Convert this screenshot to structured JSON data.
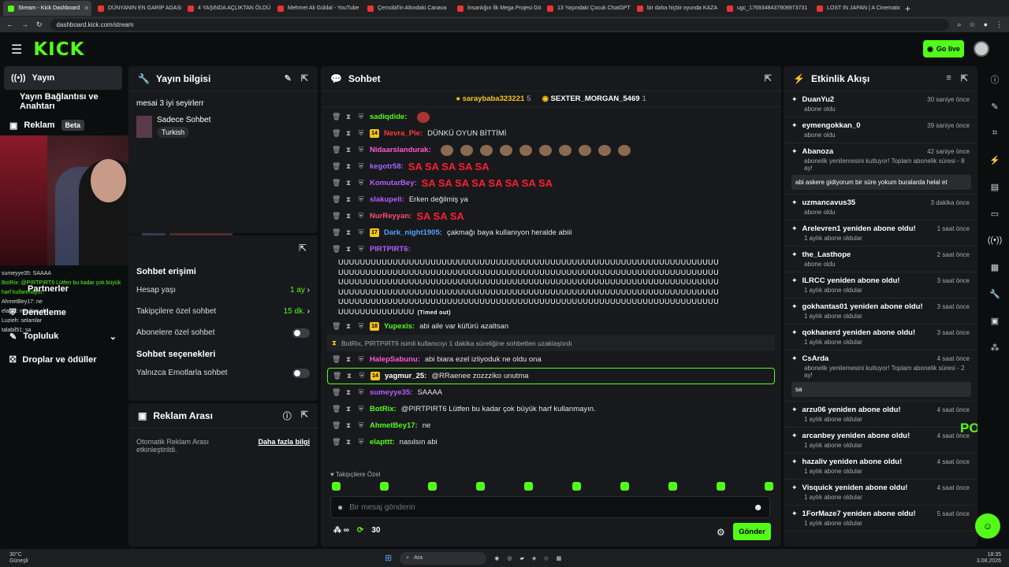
{
  "browser": {
    "tabs": [
      {
        "title": "Stream - Kick Dashboard",
        "kick": true
      },
      {
        "title": "DÜNYANIN EN GARİP ADASI"
      },
      {
        "title": "4 YAŞINDA AÇLIKTAN ÖLDÜ"
      },
      {
        "title": "Mehmet Ali Güldal - YouTube"
      },
      {
        "title": "Çernobil'in Altındaki Canava"
      },
      {
        "title": "İnsanlığın İlk Mega Projesi Gö"
      },
      {
        "title": "13 Yaşındaki Çocuk ChatGPT"
      },
      {
        "title": "bir daha hiçbir oyunda KAZA"
      },
      {
        "title": "ugc_1769348437908973731"
      },
      {
        "title": "LOST IN JAPAN | A Cinematic"
      }
    ],
    "url": "dashboard.kick.com/stream"
  },
  "topnav": {
    "logo": "KICK",
    "golive": "Go live"
  },
  "sidebar": {
    "items": [
      {
        "label": "Yayın"
      },
      {
        "label": "Yayın Bağlantısı ve Anahtarı"
      },
      {
        "label": "Reklam",
        "badge": "Beta"
      },
      {
        "label": "Partnerler"
      },
      {
        "label": "Denetleme"
      },
      {
        "label": "Topluluk"
      },
      {
        "label": "Droplar ve ödüller"
      }
    ]
  },
  "overlay_chat": [
    "sumeyye35: SAAAA",
    "BotRix: @PIRTPIRT6 Lütfen bu kadar çok büyük harf kullanmayın.",
    "AhmetBey17: ne",
    "elapttt: nasılsın abi",
    "Luzieh: selamlar",
    "talabil51: sa"
  ],
  "stream_info": {
    "title": "Yayın bilgisi",
    "stream_title": "mesai 3 iyi seyirlerr",
    "category": "Sadece Sohbet",
    "tag": "Turkish"
  },
  "chat_access": {
    "title": "Sohbet erişimi",
    "rows": [
      {
        "label": "Hesap yaşı",
        "value": "1 ay"
      },
      {
        "label": "Takipçilere özel sohbet",
        "value": "15 dk."
      },
      {
        "label": "Abonelere özel sohbet"
      }
    ],
    "options_title": "Sohbet seçenekleri",
    "options": [
      {
        "label": "Yalnızca Emotlarla sohbet"
      }
    ]
  },
  "ad_break": {
    "title": "Reklam Arası",
    "text": "Otomatik Reklam Arası etkinleştirildi.",
    "link": "Daha fazla bilgi"
  },
  "chat": {
    "title": "Sohbet",
    "pinned": [
      {
        "name": "saraybaba323221",
        "count": "5"
      },
      {
        "name": "SEXTER_MORGAN_5469",
        "count": "1"
      }
    ],
    "messages": [
      {
        "user": "sadiqdide",
        "color": "#53fc18",
        "text": ""
      },
      {
        "user": "Nevra_Pie",
        "color": "#ff3b3b",
        "badge": "14",
        "text": "DÜNKÜ OYUN BİTTİMİ"
      },
      {
        "user": "Nidaarslandurak",
        "color": "#ff5ad2",
        "text": ""
      },
      {
        "user": "kegotr58",
        "color": "#9b6bff",
        "text": "SA SA SA SA SA",
        "big": true
      },
      {
        "user": "KomutarBey",
        "color": "#b75cff",
        "text": "SA SA SA SA SA SA SA SA",
        "big": true
      },
      {
        "user": "slakupeli",
        "color": "#b75cff",
        "text": "Erken değilmiş ya"
      },
      {
        "user": "NurReyyan",
        "color": "#ff4d6d",
        "text": "SA SA SA",
        "big": true
      },
      {
        "user": "Dark_night1905",
        "color": "#4fa3ff",
        "badge": "17",
        "text": "çakmağı baya kullanıyon heralde abiii"
      },
      {
        "user": "PIRTPIRT6",
        "color": "#b75cff",
        "text": ""
      }
    ],
    "spam": "UUUUUUUUUUUUUUUUUUUUUUUUUUUUUUUUUUUUUUUUUUUUUUUUUUUUUUUUUUUUUUUUUUUUUUUUUUUUUUUUUUUUUUUUUUUUUUUUUUUUUUUUUUUUUUUUUUUUUUUUUUUUUUUUUUUUUUUUUUUUUUUUUUUUUUUUUUUUUUUUUUUUUUUUUUUUUUUUUUUUUUUUUUUUUUUUUUUUUUUUUUUUUUUUUUUUUUUUUUUUUUUUUUUUUUUUUUUUUUUUUUUUUUUUUUUUUUUUUUUUUUUUUUUUUUUUUUUUUUUUUUUUUUUUUUUUUUUUUUUUUUUUUUUUUUUUUUUUUUUUUUUUUUUUUUUUUUUUUUUUUUUUUUUUUUUUUUUUUUUUUUUU",
    "spam_tag": "(Timed out)",
    "messages2": [
      {
        "user": "Yupexis",
        "color": "#53fc18",
        "badge": "18",
        "text": "abi aile var küfürü azaltsan"
      },
      {
        "system": "BotRix, PIRTPIRT6 isimli kullanıcıyı 1 dakika süreliğine sohbetten uzaklaştırdı"
      },
      {
        "user": "HalepSabunu",
        "color": "#ff5ad2",
        "text": "abi biara ezel izliyoduk ne oldu ona"
      },
      {
        "user": "yagmur_25",
        "color": "#ffffff",
        "badge": "14",
        "text": "@RRaenee zozzziko unutma",
        "highlight": true
      },
      {
        "user": "sumeyye35",
        "color": "#b75cff",
        "text": "SAAAA"
      },
      {
        "user": "BotRix",
        "color": "#53fc18",
        "text": "@PIRTPIRT6 Lütfen bu kadar çok büyük harf kullanmayın."
      },
      {
        "user": "AhmetBey17",
        "color": "#53fc18",
        "text": "ne"
      },
      {
        "user": "elapttt",
        "color": "#53fc18",
        "text": "nasılsın abi"
      }
    ],
    "followers_label": "Takipçilere Özel",
    "input_placeholder": "Bir mesaj gönderin",
    "points": "30",
    "send": "Gönder"
  },
  "activity": {
    "title": "Etkinlik Akışı",
    "items": [
      {
        "name": "DuanYu2",
        "time": "30 saniye önce",
        "sub": "abone oldu"
      },
      {
        "name": "eymengokkan_0",
        "time": "39 saniye önce",
        "sub": "abone oldu"
      },
      {
        "name": "Abanoza",
        "time": "42 saniye önce",
        "sub": "abonelik yenilemesini kutluyor! Toplam abonelik süresi - 8 ay!",
        "msg": "abi askere gidiyorum bir süre yokum buralarda helal et"
      },
      {
        "name": "uzmancavus35",
        "time": "3 dakika önce",
        "sub": "abone oldu"
      },
      {
        "name": "Arelevren1 yeniden abone oldu!",
        "time": "1 saat önce",
        "sub": "1 aylık abone oldular"
      },
      {
        "name": "the_Lasthope",
        "time": "2 saat önce",
        "sub": "abone oldu"
      },
      {
        "name": "ILRCC yeniden abone oldu!",
        "time": "3 saat önce",
        "sub": "1 aylık abone oldular"
      },
      {
        "name": "gokhantas01 yeniden abone oldu!",
        "time": "3 saat önce",
        "sub": "1 aylık abone oldular"
      },
      {
        "name": "qokhanerd yeniden abone oldu!",
        "time": "3 saat önce",
        "sub": "1 aylık abone oldular"
      },
      {
        "name": "CsArda",
        "time": "4 saat önce",
        "sub": "abonelik yenilemesini kutluyor! Toplam abonelik süresi - 2 ay!",
        "msg": "sa"
      },
      {
        "name": "arzu06 yeniden abone oldu!",
        "time": "4 saat önce",
        "sub": "1 aylık abone oldular"
      },
      {
        "name": "arcanbey yeniden abone oldu!",
        "time": "4 saat önce",
        "sub": "1 aylık abone oldular"
      },
      {
        "name": "hazaliv yeniden abone oldu!",
        "time": "4 saat önce",
        "sub": "1 aylık abone oldular"
      },
      {
        "name": "Visquick yeniden abone oldu!",
        "time": "4 saat önce",
        "sub": "1 aylık abone oldular"
      },
      {
        "name": "1ForMaze7 yeniden abone oldu!",
        "time": "5 saat önce",
        "sub": "1 aylık abone oldular"
      }
    ],
    "power": "POWER"
  },
  "taskbar": {
    "weather": "30°C",
    "weather_sub": "Güneşli",
    "search": "Ara",
    "time": "18:35",
    "date": "3.08.2026"
  }
}
